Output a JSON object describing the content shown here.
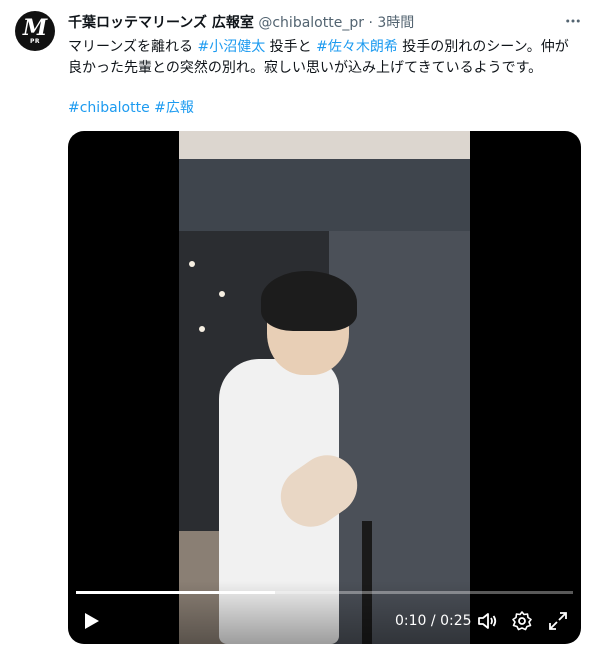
{
  "account": {
    "avatar_letter": "M",
    "avatar_sub": "PR",
    "display_name": "千葉ロッテマリーンズ 広報室",
    "handle": "@chibalotte_pr",
    "separator": "·",
    "time_ago": "3時間"
  },
  "tweet": {
    "text_1": "マリーンズを離れる ",
    "tag_1": "#小沼健太",
    "text_2": " 投手と ",
    "tag_2": "#佐々木朗希",
    "text_3": " 投手の別れのシーン。仲が良かった先輩との突然の別れ。寂しい思いが込み上げてきているようです。",
    "hashtag_1": "#chibalotte",
    "hashtag_2": "#広報"
  },
  "video": {
    "current_time": "0:10",
    "time_separator": "/",
    "duration": "0:25",
    "progress_fraction": 0.4
  },
  "icons": {
    "more": "more-icon",
    "play": "play-icon",
    "volume": "volume-icon",
    "settings": "settings-icon",
    "fullscreen": "fullscreen-icon"
  },
  "colors": {
    "link": "#1d9bf0",
    "muted_text": "#536471",
    "text": "#0f1419"
  }
}
